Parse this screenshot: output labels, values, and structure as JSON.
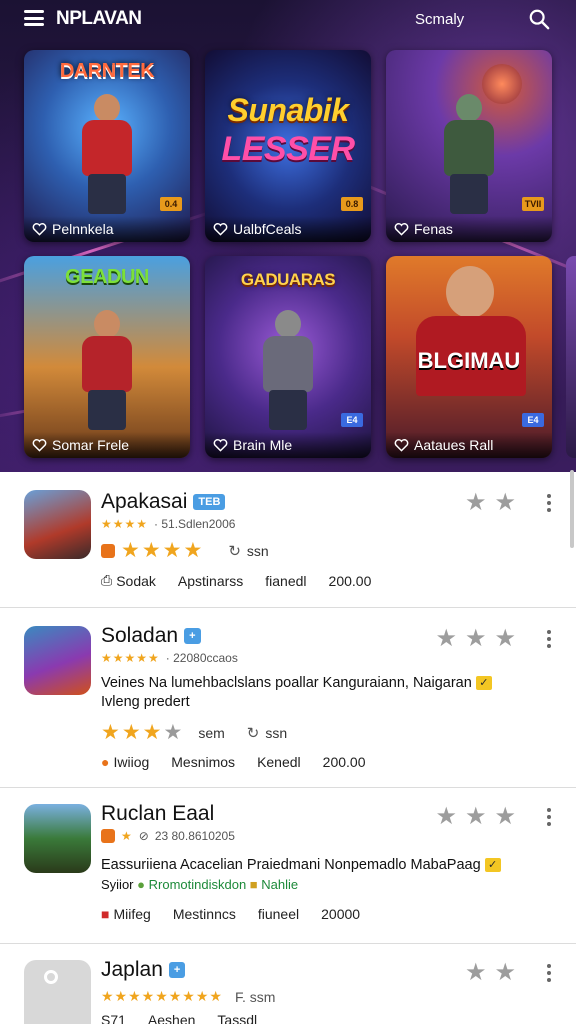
{
  "app": {
    "title": "NPLAVAN",
    "top_link": "Scmaly"
  },
  "colors": {
    "hero_bg": "#2a1747",
    "star": "#f0a51e",
    "tag_blue": "#4a9de3",
    "divider": "#dcdcdc"
  },
  "cards": [
    {
      "title_art": "DARNTEK",
      "caption": "Pеlnnkela",
      "badge": "0.4",
      "icon": "heart-icon"
    },
    {
      "title_art": "Sunabik",
      "title_art2": "LESSER",
      "caption": "UalbfCeals",
      "badge": "0.8",
      "icon": "heart-icon"
    },
    {
      "title_art": "",
      "caption": "Fenas",
      "badge": "TVII",
      "icon": "heart-icon"
    },
    {
      "title_art": "GEADUN",
      "caption": "Somar Frele",
      "badge": "",
      "icon": "heart-icon"
    },
    {
      "title_art": "GADUARAS",
      "caption": "Brain Mle",
      "badge": "E4",
      "icon": "heart-icon"
    },
    {
      "title_art": "BLGIMAU",
      "caption": "Aataues Rall",
      "badge": "E4",
      "icon": "heart-icon"
    }
  ],
  "list": [
    {
      "name": "Apakasai",
      "tag": "TEB",
      "meta_stars": "★★★★",
      "meta_text": "· 51.Sdlen2006",
      "rating_stars": "★★★★",
      "rating_off": "",
      "rating_extra": "ssn",
      "stats": [
        "Sodak",
        "Apstinarss",
        "fianedl",
        "200.00"
      ]
    },
    {
      "name": "Soladan",
      "tag": "+",
      "meta_stars": "★★★★★",
      "meta_text": "· 22080ccaos",
      "desc_lines": [
        "Veines Na lumehbaclslans poallar Kanguraiann, Naigaran",
        "Ivleng predert"
      ],
      "rating_stars": "★★★",
      "rating_off": "★",
      "rating_extra": "sem",
      "rating_extra2": "ssn",
      "stats": [
        "Iwiiog",
        "Mesnimos",
        "Kenedl",
        "200.00"
      ]
    },
    {
      "name": "Ruclan Eaal",
      "tag": "",
      "meta_stars": "★",
      "meta_text": "23 80.8610205",
      "desc_lines": [
        "Eassuriiena Acacelian Praiedmani Nonpemadlo MabaPaag"
      ],
      "desc_prefix": "Syiior",
      "desc_green": "Rromotindiskdon",
      "desc_after": "Nahlie",
      "stats": [
        "Miifeg",
        "Mestinncs",
        "fiuneel",
        "20000"
      ]
    },
    {
      "name": "Japlan",
      "tag": "+",
      "meta_stars": "★★★★★★★★★",
      "meta_text": "F. ssm",
      "stats": [
        "S71",
        "Aeshen",
        "Tassdl"
      ]
    }
  ]
}
